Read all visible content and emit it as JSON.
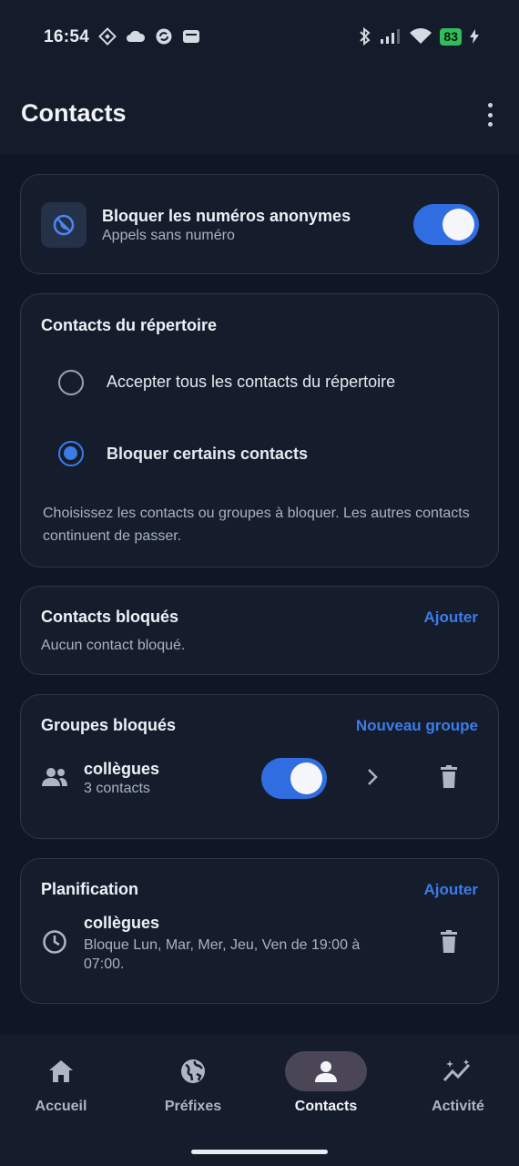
{
  "status_bar": {
    "time": "16:54",
    "battery": "83"
  },
  "header": {
    "title": "Contacts"
  },
  "anonymous": {
    "title": "Bloquer les numéros anonymes",
    "subtitle": "Appels sans numéro",
    "enabled": true
  },
  "directory": {
    "title": "Contacts du répertoire",
    "options": [
      {
        "label": "Accepter tous les contacts du répertoire",
        "selected": false
      },
      {
        "label": "Bloquer certains contacts",
        "selected": true
      }
    ],
    "help": "Choisissez les contacts ou groupes à bloquer. Les autres contacts continuent de passer."
  },
  "blocked_contacts": {
    "title": "Contacts bloqués",
    "action": "Ajouter",
    "empty": "Aucun contact bloqué."
  },
  "blocked_groups": {
    "title": "Groupes bloqués",
    "action": "Nouveau groupe",
    "items": [
      {
        "name": "collègues",
        "count": "3 contacts",
        "enabled": true
      }
    ]
  },
  "schedule": {
    "title": "Planification",
    "action": "Ajouter",
    "items": [
      {
        "name": "collègues",
        "detail": "Bloque Lun, Mar, Mer, Jeu, Ven de 19:00 à 07:00."
      }
    ]
  },
  "bottom_nav": {
    "items": [
      {
        "label": "Accueil",
        "icon": "home-icon",
        "active": false
      },
      {
        "label": "Préfixes",
        "icon": "globe-icon",
        "active": false
      },
      {
        "label": "Contacts",
        "icon": "person-icon",
        "active": true
      },
      {
        "label": "Activité",
        "icon": "activity-icon",
        "active": false
      }
    ]
  },
  "colors": {
    "accent": "#3d7be8",
    "background": "#0f1626",
    "card": "#151d2d",
    "toggle_on": "#2f6de0"
  }
}
